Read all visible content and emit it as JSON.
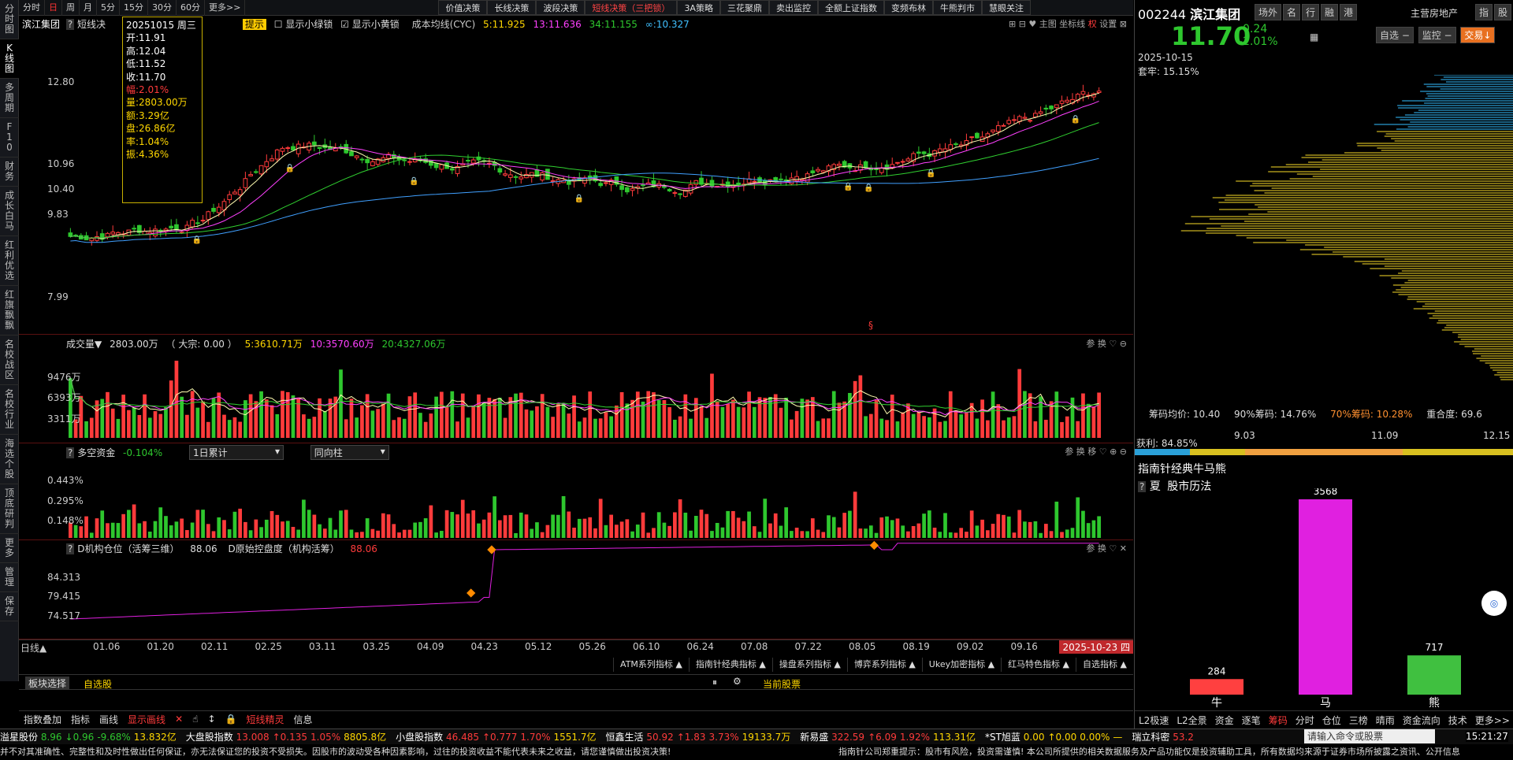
{
  "leftbar": [
    "分时图",
    "K线图",
    "多周期",
    "F10",
    "财务",
    "成长白马",
    "红利优选",
    "红旗飘飘",
    "名校战区",
    "名校行业",
    "海选个股",
    "顶底研判",
    "更多",
    "管理",
    "保存"
  ],
  "topbar": {
    "periods": [
      "分时",
      "日",
      "周",
      "月",
      "5分",
      "15分",
      "30分",
      "60分",
      "更多>>"
    ],
    "strategies": [
      "价值决策",
      "长线决策",
      "波段决策",
      "短线决策（三把锁）",
      "3A策略",
      "三花聚鼎",
      "卖出监控",
      "全额上证指数",
      "变频布林",
      "牛熊判市",
      "慧眼关注"
    ]
  },
  "main": {
    "stock_name": "滨江集团",
    "short_tab": "短线决",
    "tip_label": "提示",
    "show_green": "显示小绿锁",
    "show_yellow": "显示小黄锁",
    "ma_title": "成本均线(CYC)",
    "ma5": "5:11.925",
    "ma13": "13:11.636",
    "ma34": "34:11.155",
    "ma_inf": "∞:10.327",
    "tools": [
      "主图",
      "坐标线",
      "权",
      "设置"
    ],
    "yticks": [
      "12.80",
      "10.96",
      "10.40",
      "9.83",
      "7.99"
    ],
    "tooltip": {
      "date": "20251015",
      "weekday": "周三",
      "open": "开:11.91",
      "high": "高:12.04",
      "low": "低:11.52",
      "close": "收:11.70",
      "chg": "幅:2.01%",
      "vol": "量:2803.00万",
      "amt": "额:3.29亿",
      "pan": "盘:26.86亿",
      "rate": "率:1.04%",
      "amp": "振:4.36%"
    },
    "marker": "§"
  },
  "volume": {
    "title": "成交量▼",
    "val": "2803.00万",
    "dz": "（ 大宗: 0.00 ）",
    "m5": "5:3610.71万",
    "m10": "10:3570.60万",
    "m20": "20:4327.06万",
    "yticks": [
      "9476万",
      "6393万",
      "3311万"
    ],
    "tools": "参 换 ♡ ⊖"
  },
  "duokong": {
    "title": "多空资金",
    "val": "-0.104%",
    "sel1": "1日累计",
    "sel2": "同向柱",
    "yticks": [
      "0.443%",
      "0.295%",
      "0.148%"
    ],
    "tools": "参 换 移 ♡ ⊕ ⊖"
  },
  "jigou": {
    "title": "D机构仓位（活筹三维）",
    "val": "88.06",
    "title2": "D原始控盘度（机构活筹）",
    "val2": "88.06",
    "yticks": [
      "84.313",
      "79.415",
      "74.517"
    ],
    "tools": "参 换 ♡ ✕"
  },
  "dates": [
    "01.06",
    "01.20",
    "02.11",
    "02.25",
    "03.11",
    "03.25",
    "04.09",
    "04.23",
    "05.12",
    "05.26",
    "06.10",
    "06.24",
    "07.08",
    "07.22",
    "08.05",
    "08.19",
    "09.02",
    "09.16"
  ],
  "date_current": "2025-10-23 四",
  "dateline_label": "日线▲",
  "indicators": [
    "ATM系列指标 ▲",
    "指南针经典指标 ▲",
    "操盘系列指标 ▲",
    "博弈系列指标 ▲",
    "Ukey加密指标 ▲",
    "红马特色指标 ▲",
    "自选指标 ▲"
  ],
  "blocks": {
    "sel": "板块选择",
    "zx": "自选股",
    "cur": "当前股票"
  },
  "tools_bottom": [
    "指数叠加",
    "指标",
    "画线",
    "显示画线",
    "✕",
    "☝",
    "↕",
    "🔒",
    "短线精灵",
    "信息"
  ],
  "side": {
    "code": "002244",
    "name": "滨江集团",
    "tags": [
      "场外",
      "名",
      "行",
      "融",
      "港"
    ],
    "sector": "主营房地产",
    "btn_idx": "指",
    "btn_stock": "股",
    "price": "11.70",
    "chg": "-0.24",
    "pct": "-2.01%",
    "btn1": "自选 −",
    "btn2": "监控 −",
    "btn3": "交易↓",
    "date": "2025-10-15",
    "taolao": "套牢: 15.15%",
    "avg": "筹码均价: 10.40",
    "c90": "90%筹码: 14.76%",
    "c70": "70%筹码: 10.28%",
    "overlap": "重合度: 69.6",
    "profit": "获利: 84.85%",
    "scale": [
      "9.03",
      "11.09",
      "12.15"
    ],
    "title2": "指南针经典牛马熊",
    "xia": "夏",
    "history": "股市历法",
    "bars": [
      {
        "label": "牛",
        "value": 284,
        "color": "#ff4040"
      },
      {
        "label": "马",
        "value": 3568,
        "color": "#e020e0"
      },
      {
        "label": "熊",
        "value": 717,
        "color": "#40c040"
      }
    ],
    "tabs": [
      "L2极速",
      "L2全景",
      "资金",
      "逐笔",
      "筹码",
      "分时",
      "仓位",
      "三榜",
      "晴雨",
      "资金流向",
      "技术",
      "更多>>"
    ]
  },
  "ticker": [
    {
      "n": "溢星股份",
      "v": "8.96",
      "c": "↓0.96",
      "p": "-9.68%",
      "a": "13.832亿",
      "col": "green"
    },
    {
      "n": "大盘股指数",
      "v": "13.008",
      "c": "↑0.135",
      "p": "1.05%",
      "a": "8805.8亿",
      "col": "red"
    },
    {
      "n": "小盘股指数",
      "v": "46.485",
      "c": "↑0.777",
      "p": "1.70%",
      "a": "1551.7亿",
      "col": "red"
    },
    {
      "n": "恒鑫生活",
      "v": "50.92",
      "c": "↑1.83",
      "p": "3.73%",
      "a": "19133.7万",
      "col": "red"
    },
    {
      "n": "新易盛",
      "v": "322.59",
      "c": "↑6.09",
      "p": "1.92%",
      "a": "113.31亿",
      "col": "red"
    },
    {
      "n": "*ST旭蓝",
      "v": "0.00",
      "c": "↑0.00",
      "p": "0.00%",
      "a": "—",
      "col": "yel"
    },
    {
      "n": "瑞立科密",
      "v": "53.2",
      "c": "",
      "p": "",
      "a": "",
      "col": "red"
    }
  ],
  "cmd_placeholder": "请输入命令或股票",
  "time": "15:21:27",
  "disclaimer1": "并不对其准确性、完整性和及时性做出任何保证，亦无法保证您的投资不受损失。因股市的波动受各种因素影响，过往的投资收益不能代表未来之收益，请您谨慎做出投资决策!",
  "disclaimer2": "指南针公司郑重提示：股市有风险，投资需谨慎! 本公司所提供的相关数据服务及产品功能仅是投资辅助工具，所有数据均来源于证券市场所披露之资讯、公开信息",
  "colors": {
    "up": "#ff3b3b",
    "down": "#2ec72e",
    "ma5": "#fffcb0",
    "ma13": "#ff40ff",
    "ma34": "#30d030",
    "mainf": "#40a0ff"
  }
}
